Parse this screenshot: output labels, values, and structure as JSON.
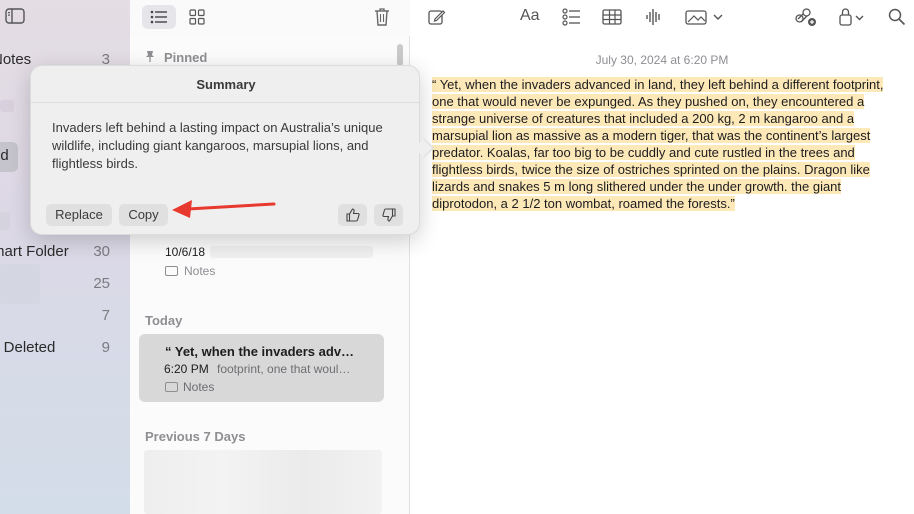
{
  "sidebar": {
    "items": [
      {
        "label": "Notes",
        "count": "3"
      },
      {
        "label": "ud",
        "count": ""
      },
      {
        "label": "mart Folder",
        "count": "30"
      },
      {
        "label": "",
        "count": "25"
      },
      {
        "label": "",
        "count": "7"
      },
      {
        "label": "y Deleted",
        "count": "9"
      }
    ]
  },
  "list": {
    "pinned_label": "Pinned",
    "older_note": {
      "date": "10/6/18",
      "folder": "Notes"
    },
    "today_label": "Today",
    "selected_note": {
      "title": "“ Yet, when the invaders adv…",
      "time": "6:20 PM",
      "preview": "footprint, one that woul…",
      "folder": "Notes"
    },
    "prev7_label": "Previous 7 Days"
  },
  "editor": {
    "date": "July 30, 2024 at 6:20 PM",
    "body": "“ Yet, when the invaders advanced in land, they left behind a different footprint, one that would never be expunged. As they pushed on, they encountered a strange universe of creatures that included a 200 kg, 2 m kangaroo and a marsupial lion as massive as a modern tiger, that was the continent’s largest predator. Koalas, far too big to be cuddly and cute rustled in the trees and flightless birds, twice the size of ostriches sprinted on the plains. Dragon like lizards and snakes 5 m long slithered under the under growth. the giant diprotodon, a 2 1/2 ton wombat, roamed the forests.”",
    "highlight_color": "#fde8b8"
  },
  "summary_popover": {
    "title": "Summary",
    "text": "Invaders left behind a lasting impact on Australia’s unique wildlife, including giant kangaroos, marsupial lions, and flightless birds.",
    "replace_label": "Replace",
    "copy_label": "Copy",
    "thumbs_up_icon": "thumbs-up-icon",
    "thumbs_down_icon": "thumbs-down-icon"
  },
  "annotation": {
    "arrow_color": "#e8392f"
  }
}
